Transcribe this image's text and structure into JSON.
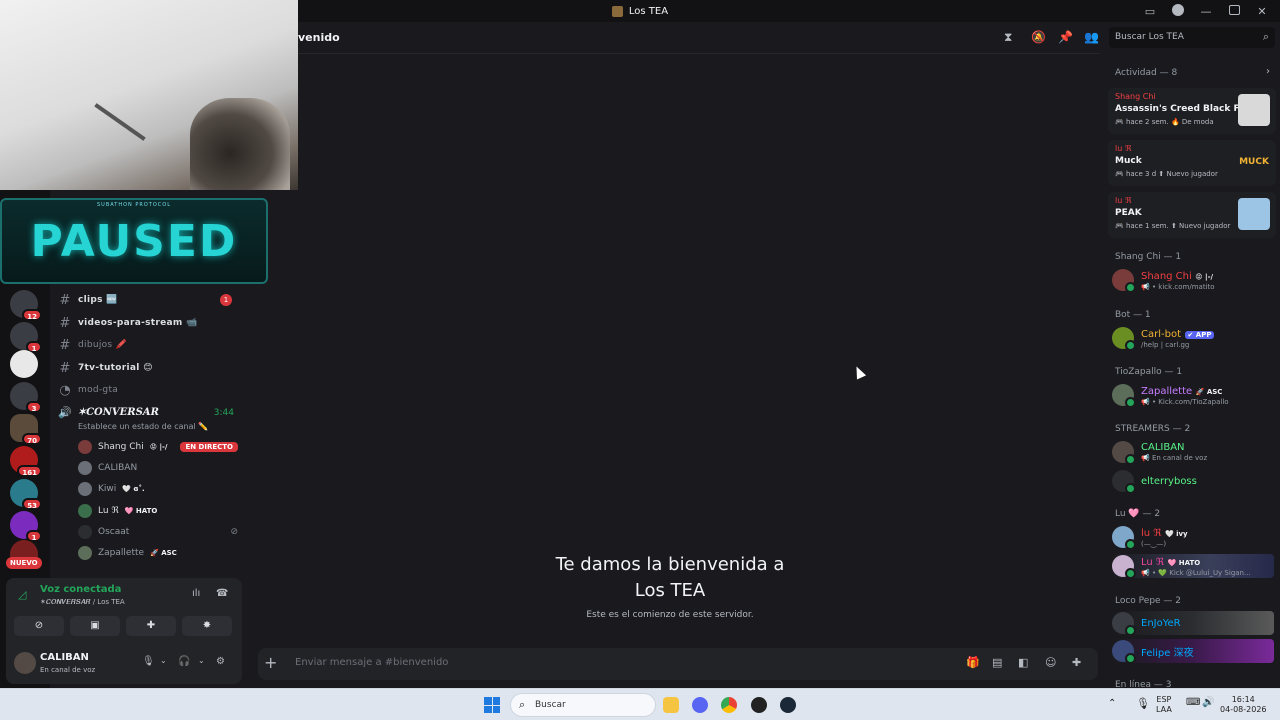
{
  "window": {
    "title": "Los TEA"
  },
  "overlay": {
    "paused_text": "PAUSED",
    "paused_sub": "SUBATHON PROTOCOL"
  },
  "servers": [
    {
      "badge": "12"
    },
    {
      "badge": "1"
    },
    {
      "badge": ""
    },
    {
      "badge": "3"
    },
    {
      "badge": "70"
    },
    {
      "badge": "161"
    },
    {
      "badge": "53"
    },
    {
      "badge": "1"
    }
  ],
  "servers_new_label": "NUEVO",
  "channels": [
    {
      "name": "clips 🆕",
      "unread": "1"
    },
    {
      "name": "videos-para-stream 📹",
      "unread": ""
    },
    {
      "name": "dibujos 🖍️",
      "unread": ""
    },
    {
      "name": "7tv-tutorial 😊",
      "unread": ""
    },
    {
      "name": "mod-gta",
      "unread": ""
    }
  ],
  "voice_channel": {
    "name": "✶𝑪𝑶𝑵𝑽𝑬𝑹𝑺𝑨𝑹",
    "time": "3:44",
    "status": "Establece un estado de canal ✏️",
    "users": [
      {
        "name": "Shang Chi",
        "tag": "😡 |-/",
        "live": "EN DIRECTO"
      },
      {
        "name": "CALIBAN",
        "tag": ""
      },
      {
        "name": "Kiwi",
        "tag": "🤍 ɞ˚."
      },
      {
        "name": "Lu ℜ",
        "tag": "🩷 HATO"
      },
      {
        "name": "Oscaat",
        "tag": ""
      },
      {
        "name": "Zapallette",
        "tag": "🚀 ASC"
      }
    ]
  },
  "voice_panel": {
    "connected": "Voz conectada",
    "location": "✶𝑪𝑶𝑵𝑽𝑬𝑹𝑺𝑨𝑹 / Los TEA",
    "user": "CALIBAN",
    "user_status": "En canal de voz"
  },
  "main": {
    "channel_title": "venido",
    "welcome_line1": "Te damos la bienvenida a",
    "welcome_line2": "Los TEA",
    "welcome_sub": "Este es el comienzo de este servidor.",
    "composer_placeholder": "Enviar mensaje a #bienvenido"
  },
  "search": {
    "placeholder": "Buscar Los TEA"
  },
  "activity": {
    "header": "Actividad — 8",
    "cards": [
      {
        "user": "Shang Chi",
        "game": "Assassin's Creed Black Fla...",
        "meta": "🎮 hace 2 sem.  🔥 De moda",
        "thumb_text": ""
      },
      {
        "user": "lu ℜ",
        "game": "Muck",
        "meta": "🎮 hace 3 d  ⬆ Nuevo jugador",
        "thumb_text": "MUCK"
      },
      {
        "user": "lu ℜ",
        "game": "PEAK",
        "meta": "🎮 hace 1 sem.  ⬆ Nuevo jugador",
        "thumb_text": ""
      }
    ]
  },
  "members": {
    "groups": [
      {
        "title": "Shang Chi — 1",
        "items": [
          {
            "name": "Shang Chi",
            "tag": "😡 |-/",
            "status": "📢 • kick.com/matito",
            "color": "#f23f43"
          }
        ]
      },
      {
        "title": "Bot — 1",
        "items": [
          {
            "name": "Carl-bot",
            "tag": "✔ APP",
            "status": "/help | carl.gg",
            "color": "#f0b232"
          }
        ]
      },
      {
        "title": "TioZapallo — 1",
        "items": [
          {
            "name": "Zapallette",
            "tag": "🚀 ASC",
            "status": "📢 • Kick.com/TioZapallo",
            "color": "#c77dff"
          }
        ]
      },
      {
        "title": "STREAMERS — 2",
        "items": [
          {
            "name": "CALIBAN",
            "tag": "",
            "status": "📢 En canal de voz",
            "color": "#57f287"
          },
          {
            "name": "elterryboss",
            "tag": "",
            "status": "",
            "color": "#57f287"
          }
        ]
      },
      {
        "title": "Lu 🩷 — 2",
        "items": [
          {
            "name": "lu ℜ",
            "tag": "🤍 ivy",
            "status": "(—‿—)",
            "color": "#f23f43"
          },
          {
            "name": "Lu ℜ",
            "tag": "🩷 HATO",
            "status": "📢 • 💚 Kick @Lului_Uy Sigan...",
            "color": "#eb459e"
          }
        ]
      },
      {
        "title": "Loco Pepe — 2",
        "items": [
          {
            "name": "EnJoYeR",
            "tag": "",
            "status": "",
            "color": "#00a8fc"
          },
          {
            "name": "Felipe 深夜",
            "tag": "",
            "status": "",
            "color": "#00a8fc"
          }
        ]
      },
      {
        "title": "En línea — 3",
        "items": []
      }
    ]
  },
  "taskbar": {
    "search_placeholder": "Buscar",
    "lang_top": "ESP",
    "lang_bottom": "LAA",
    "time": "16:14",
    "date": "04-08-2026"
  }
}
